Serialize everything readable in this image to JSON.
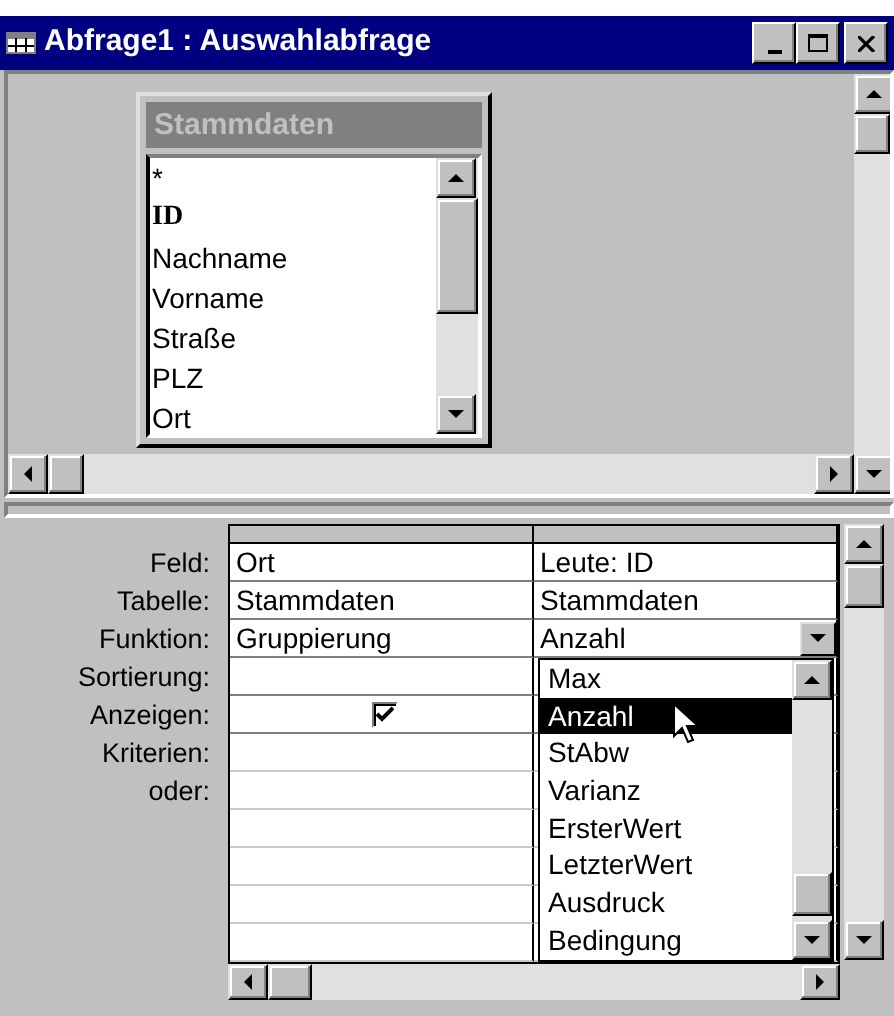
{
  "window": {
    "title": "Abfrage1 : Auswahlabfrage"
  },
  "field_list": {
    "title": "Stammdaten",
    "fields": [
      {
        "name": "*",
        "primary_key": false
      },
      {
        "name": "ID",
        "primary_key": true
      },
      {
        "name": "Nachname",
        "primary_key": false
      },
      {
        "name": "Vorname",
        "primary_key": false
      },
      {
        "name": "Straße",
        "primary_key": false
      },
      {
        "name": "PLZ",
        "primary_key": false
      },
      {
        "name": "Ort",
        "primary_key": false
      }
    ]
  },
  "grid": {
    "row_labels": [
      "Feld:",
      "Tabelle:",
      "Funktion:",
      "Sortierung:",
      "Anzeigen:",
      "Kriterien:",
      "oder:"
    ],
    "columns": [
      {
        "field": "Ort",
        "table": "Stammdaten",
        "function": "Gruppierung",
        "show": true
      },
      {
        "field": "Leute: ID",
        "table": "Stammdaten",
        "function": "Anzahl",
        "dropdown_open": true
      }
    ]
  },
  "dropdown": {
    "options": [
      {
        "label": "Max",
        "selected": false
      },
      {
        "label": "Anzahl",
        "selected": true
      },
      {
        "label": "StAbw",
        "selected": false
      },
      {
        "label": "Varianz",
        "selected": false
      },
      {
        "label": "ErsterWert",
        "selected": false
      },
      {
        "label": "LetzterWert",
        "selected": false
      },
      {
        "label": "Ausdruck",
        "selected": false
      },
      {
        "label": "Bedingung",
        "selected": false
      }
    ]
  }
}
